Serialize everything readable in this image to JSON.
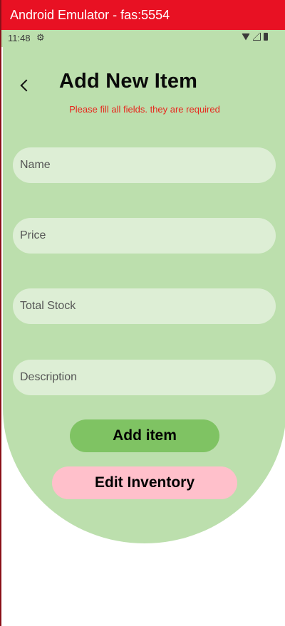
{
  "window": {
    "title": "Android Emulator - fas:5554"
  },
  "statusbar": {
    "time": "11:48",
    "icons": [
      "gear-icon",
      "wifi-icon",
      "signal-icon",
      "battery-icon"
    ]
  },
  "header": {
    "back_icon": "chevron-left-icon",
    "title": "Add New Item",
    "hint": "Please fill all fields. they are required"
  },
  "form": {
    "name": {
      "placeholder": "Name",
      "value": ""
    },
    "price": {
      "placeholder": "Price",
      "value": ""
    },
    "total_stock": {
      "placeholder": "Total Stock",
      "value": ""
    },
    "description": {
      "placeholder": "Description",
      "value": ""
    }
  },
  "actions": {
    "add_label": "Add item",
    "edit_label": "Edit Inventory"
  },
  "colors": {
    "titlebar": "#e81123",
    "background": "#bcdfad",
    "field": "#ddeed5",
    "hint": "#e8271e",
    "add_button": "#7fc363",
    "edit_button": "#ffc0cb"
  }
}
